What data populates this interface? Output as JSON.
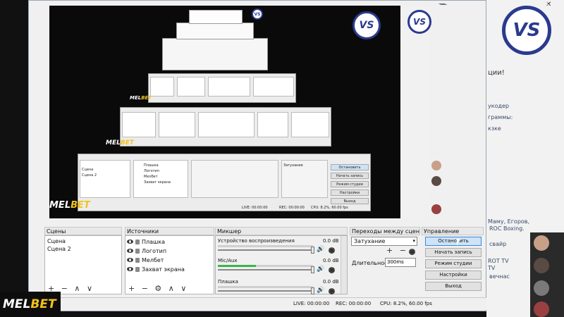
{
  "brand": {
    "melbet_left": "MEL",
    "melbet_right": "BET",
    "vs_logo": "VS"
  },
  "colors": {
    "melbet_yellow": "#f4c21b",
    "vs_blue": "#2b3a8f",
    "active_button": "#cde3f7",
    "meter_green": "#3cb44b"
  },
  "window": {
    "minimize": "—",
    "close": "✕"
  },
  "background_page": {
    "fragments": [
      "ции!",
      "укодер",
      "граммы:",
      "кзке",
      "Маму, Егоров,",
      "ROC Boxing.",
      "свайр",
      "ROT TV",
      "TV",
      "вечнас"
    ]
  },
  "docks": {
    "scenes": {
      "title": "Сцены",
      "items": [
        "Сцена",
        "Сцена 2"
      ]
    },
    "sources": {
      "title": "Источники",
      "items": [
        "Плашка",
        "Логотип",
        "Мелбет",
        "Захват экрана"
      ]
    },
    "mixer": {
      "title": "Микшер",
      "channels": [
        {
          "name": "Устройство воспроизведения",
          "db": "0.0 dB",
          "level": 0
        },
        {
          "name": "Mic/Aux",
          "db": "0.0 dB",
          "level": 0.4
        },
        {
          "name": "Плашка",
          "db": "0.0 dB",
          "level": 0
        }
      ]
    },
    "transitions": {
      "title": "Переходы между сценами",
      "selected": "Затухание",
      "duration_label": "Длительность",
      "duration_value": "300ms"
    },
    "controls": {
      "title": "Управление",
      "buttons": [
        "Остановить",
        "Начать запись",
        "Режим студии",
        "Настройки",
        "Выход"
      ]
    }
  },
  "statusbar": {
    "live": "LIVE: 00:00:00",
    "rec": "REC: 00:00:00",
    "cpu": "CPU: 8.2%, 60.00 fps"
  },
  "toolbar_symbols": {
    "scenes": "+ − ∧ ∨",
    "sources": "+ − ⚙ ∧ ∨",
    "transitions": "+ −"
  },
  "icons": {
    "speaker": "🔊",
    "dropdown": "▾"
  }
}
